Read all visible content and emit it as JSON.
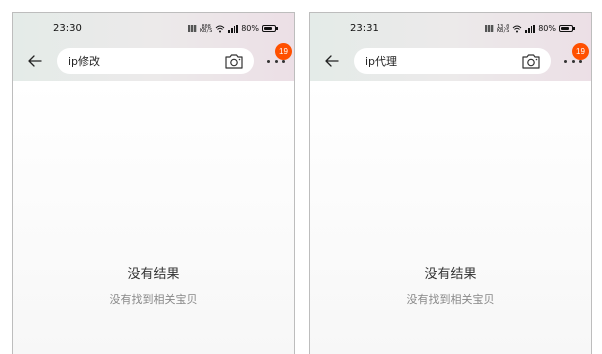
{
  "screens": [
    {
      "status": {
        "time": "23:30",
        "net_speed_top": "808",
        "net_speed_bottom": "KB/S",
        "battery": "80%"
      },
      "search": {
        "query": "ip修改"
      },
      "badge_count": "19",
      "empty": {
        "title": "没有结果",
        "subtitle": "没有找到相关宝贝"
      }
    },
    {
      "status": {
        "time": "23:31",
        "net_speed_top": "13.0",
        "net_speed_bottom": "KB/S",
        "battery": "80%"
      },
      "search": {
        "query": "ip代理"
      },
      "badge_count": "19",
      "empty": {
        "title": "没有结果",
        "subtitle": "没有找到相关宝贝"
      }
    }
  ],
  "icons": [
    "back-arrow-icon",
    "camera-icon",
    "more-icon",
    "wifi-icon",
    "signal-icon",
    "battery-icon"
  ],
  "colors": {
    "badge": "#ff5000",
    "header_left": "#e4ebe8",
    "header_right": "#ecdfe6"
  }
}
